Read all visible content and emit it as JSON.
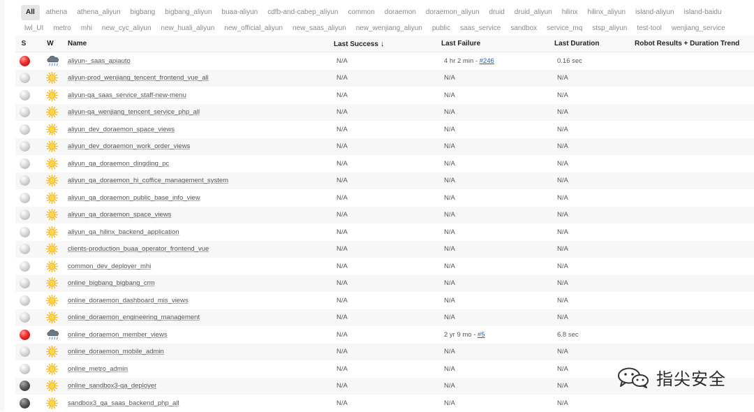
{
  "tabs": {
    "row1": [
      "All",
      "athena",
      "athena_aliyun",
      "bigbang",
      "bigbang_aliyun",
      "buaa-aliyun",
      "cdfb-and-cabep_aliyun",
      "common",
      "doraemon",
      "doraemon_aliyun",
      "druid",
      "druid_aliyun",
      "hilinx",
      "hilinx_aliyun",
      "island-aliyun",
      "island-baidu"
    ],
    "row2": [
      "lwl_UI",
      "metro",
      "mhi",
      "new_cyc_aliyun",
      "new_huali_aliyun",
      "new_official_aliyun",
      "new_saas_aliyun",
      "new_wenjiang_aliyun",
      "public",
      "saas_service",
      "sandbox",
      "service_mq",
      "stsp_aliyun",
      "test-tool",
      "wenjiang_service"
    ]
  },
  "table": {
    "headers": {
      "status": "S",
      "weather": "W",
      "name": "Name",
      "last_success": "Last Success",
      "sort_indicator": "↓",
      "last_failure": "Last Failure",
      "last_duration": "Last Duration",
      "trend": "Robot Results + Duration Trend"
    },
    "rows": [
      {
        "name": "aliyun-_saas_apiauto",
        "status": "red",
        "weather": "storm",
        "last_success": "N/A",
        "last_failure": "4 hr 2 min - ",
        "failure_build": "#246",
        "last_duration": "0.16 sec"
      },
      {
        "name": "aliyun-prod_wenjiang_tencent_frontend_vue_all",
        "status": "grey",
        "weather": "sunny",
        "last_success": "N/A",
        "last_failure": "N/A",
        "failure_build": "",
        "last_duration": "N/A"
      },
      {
        "name": "aliyun-qa_saas_service_staff-new-menu",
        "status": "grey",
        "weather": "sunny",
        "last_success": "N/A",
        "last_failure": "N/A",
        "failure_build": "",
        "last_duration": "N/A"
      },
      {
        "name": "aliyun-qa_wenjiang_tencent_service_php_all",
        "status": "grey",
        "weather": "sunny",
        "last_success": "N/A",
        "last_failure": "N/A",
        "failure_build": "",
        "last_duration": "N/A"
      },
      {
        "name": "aliyun_dev_doraemon_space_views",
        "status": "grey",
        "weather": "sunny",
        "last_success": "N/A",
        "last_failure": "N/A",
        "failure_build": "",
        "last_duration": "N/A"
      },
      {
        "name": "aliyun_dev_doraemon_work_order_views",
        "status": "grey",
        "weather": "sunny",
        "last_success": "N/A",
        "last_failure": "N/A",
        "failure_build": "",
        "last_duration": "N/A"
      },
      {
        "name": "aliyun_qa_doraemon_dingding_pc",
        "status": "grey",
        "weather": "sunny",
        "last_success": "N/A",
        "last_failure": "N/A",
        "failure_build": "",
        "last_duration": "N/A"
      },
      {
        "name": "aliyun_qa_doraemon_hi_coffice_management_system",
        "status": "grey",
        "weather": "sunny",
        "last_success": "N/A",
        "last_failure": "N/A",
        "failure_build": "",
        "last_duration": "N/A"
      },
      {
        "name": "aliyun_qa_doraemon_public_base_info_view",
        "status": "grey",
        "weather": "sunny",
        "last_success": "N/A",
        "last_failure": "N/A",
        "failure_build": "",
        "last_duration": "N/A"
      },
      {
        "name": "aliyun_qa_doraemon_space_views",
        "status": "grey",
        "weather": "sunny",
        "last_success": "N/A",
        "last_failure": "N/A",
        "failure_build": "",
        "last_duration": "N/A"
      },
      {
        "name": "aliyun_qa_hilinx_backend_application",
        "status": "grey",
        "weather": "sunny",
        "last_success": "N/A",
        "last_failure": "N/A",
        "failure_build": "",
        "last_duration": "N/A"
      },
      {
        "name": "clients-production_buaa_operator_frontend_vue",
        "status": "grey",
        "weather": "sunny",
        "last_success": "N/A",
        "last_failure": "N/A",
        "failure_build": "",
        "last_duration": "N/A"
      },
      {
        "name": "common_dev_deployer_mhi",
        "status": "grey",
        "weather": "sunny",
        "last_success": "N/A",
        "last_failure": "N/A",
        "failure_build": "",
        "last_duration": "N/A"
      },
      {
        "name": "online_bigbang_bigbang_crm",
        "status": "grey",
        "weather": "sunny",
        "last_success": "N/A",
        "last_failure": "N/A",
        "failure_build": "",
        "last_duration": "N/A"
      },
      {
        "name": "online_doraemon_dashboard_mis_views",
        "status": "grey",
        "weather": "sunny",
        "last_success": "N/A",
        "last_failure": "N/A",
        "failure_build": "",
        "last_duration": "N/A"
      },
      {
        "name": "online_doraemon_engineering_management",
        "status": "grey",
        "weather": "sunny",
        "last_success": "N/A",
        "last_failure": "N/A",
        "failure_build": "",
        "last_duration": "N/A"
      },
      {
        "name": "online_doraemon_member_views",
        "status": "red",
        "weather": "storm",
        "last_success": "N/A",
        "last_failure": "2 yr 9 mo - ",
        "failure_build": "#5",
        "last_duration": "6.8 sec"
      },
      {
        "name": "online_doraemon_mobile_admin",
        "status": "grey",
        "weather": "sunny",
        "last_success": "N/A",
        "last_failure": "N/A",
        "failure_build": "",
        "last_duration": "N/A"
      },
      {
        "name": "online_metro_admin",
        "status": "grey",
        "weather": "sunny",
        "last_success": "N/A",
        "last_failure": "N/A",
        "failure_build": "",
        "last_duration": "N/A"
      },
      {
        "name": "online_sandbox3-qa_deployer",
        "status": "dark",
        "weather": "sunny",
        "last_success": "N/A",
        "last_failure": "N/A",
        "failure_build": "",
        "last_duration": "N/A"
      },
      {
        "name": "sandbox3_qa_saas_backend_php_all",
        "status": "dark",
        "weather": "sunny",
        "last_success": "N/A",
        "last_failure": "N/A",
        "failure_build": "",
        "last_duration": "N/A"
      }
    ]
  },
  "watermark": {
    "text": "指尖安全",
    "icon": "wechat-icon"
  },
  "colors": {
    "fail_red": "#ef2a2a",
    "disabled_grey": "#c4c4c4",
    "aborted_dark": "#444444",
    "link_blue": "#2a5db0"
  }
}
